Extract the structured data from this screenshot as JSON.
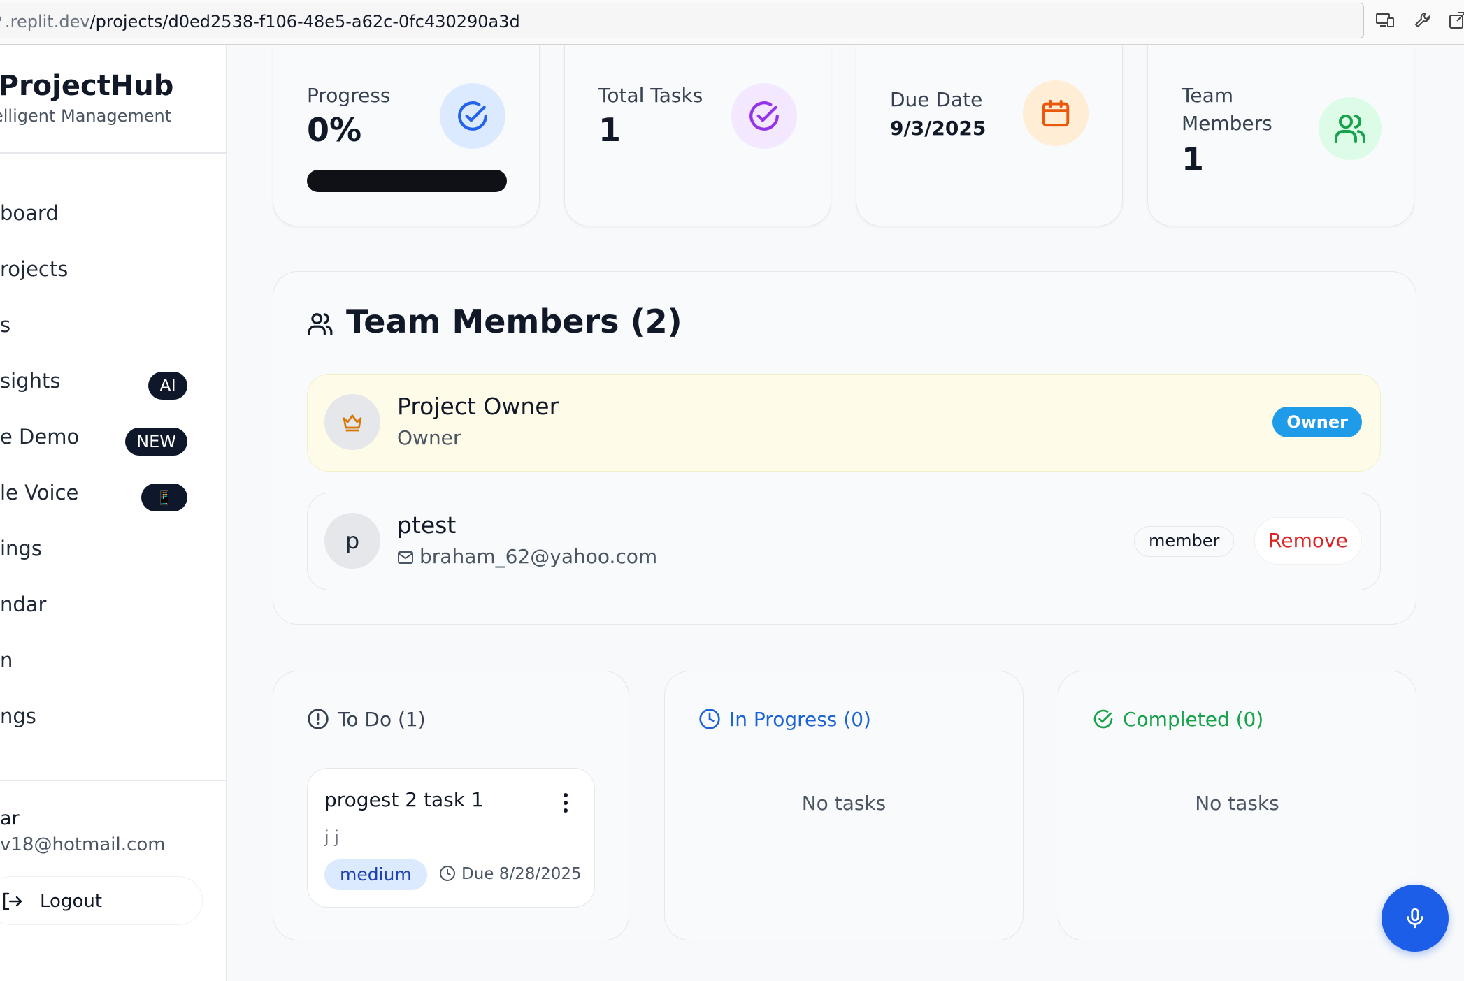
{
  "browser": {
    "url_host": ".replit.dev",
    "url_path": "/projects/d0ed2538-f106-48e5-a62c-0fc430290a3d"
  },
  "sidebar": {
    "brand_title": "l ProjectHub",
    "brand_subtitle": "elligent Management",
    "items": [
      {
        "label": "board",
        "badge": ""
      },
      {
        "label": "rojects",
        "badge": ""
      },
      {
        "label": "s",
        "badge": ""
      },
      {
        "label": "sights",
        "badge": "AI"
      },
      {
        "label": "e Demo",
        "badge": "NEW"
      },
      {
        "label": "le Voice",
        "badge": "📱"
      },
      {
        "label": "ings",
        "badge": ""
      },
      {
        "label": "ndar",
        "badge": ""
      },
      {
        "label": "n",
        "badge": ""
      },
      {
        "label": "ngs",
        "badge": ""
      }
    ],
    "user_name": "ar",
    "user_email": "v18@hotmail.com",
    "logout_label": "Logout"
  },
  "stats": {
    "progress_label": "Progress",
    "progress_value": "0%",
    "progress_fraction": 0,
    "total_tasks_label": "Total Tasks",
    "total_tasks_value": "1",
    "due_date_label": "Due Date",
    "due_date_value": "9/3/2025",
    "team_members_label_1": "Team",
    "team_members_label_2": "Members",
    "team_members_value": "1"
  },
  "team": {
    "title": "Team Members (2)",
    "owner": {
      "name": "Project Owner",
      "role": "Owner",
      "badge": "Owner"
    },
    "member": {
      "initial": "p",
      "name": "ptest",
      "email": "braham_62@yahoo.com",
      "role": "member",
      "remove_label": "Remove"
    }
  },
  "columns": {
    "todo": {
      "title": "To Do (1)"
    },
    "in_progress": {
      "title": "In Progress (0)",
      "empty": "No tasks"
    },
    "completed": {
      "title": "Completed (0)",
      "empty": "No tasks"
    }
  },
  "task": {
    "title": "progest 2 task 1",
    "description": "j j",
    "priority": "medium",
    "due": "Due 8/28/2025"
  },
  "colors": {
    "accent_blue": "#1d5ee8",
    "owner_badge": "#1e9be9",
    "in_progress": "#1d63d8",
    "completed": "#16a34a",
    "remove": "#dc2626"
  }
}
